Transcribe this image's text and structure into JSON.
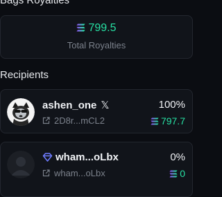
{
  "summary": {
    "title": "Bags Royalties",
    "total_amount": "799.5",
    "total_label": "Total Royalties"
  },
  "recipients": {
    "title": "Recipients",
    "items": [
      {
        "name": "ashen_one",
        "social": "𝕏",
        "address": "2D8r...mCL2",
        "percent": "100%",
        "amount": "797.7"
      },
      {
        "name": "wham...oLbx",
        "address": "wham...oLbx",
        "percent": "0%",
        "amount": "0"
      }
    ]
  },
  "colors": {
    "accent": "#27e0a3",
    "badge": "#6f7cff",
    "background": "#0b0d12",
    "card": "#11141a"
  }
}
